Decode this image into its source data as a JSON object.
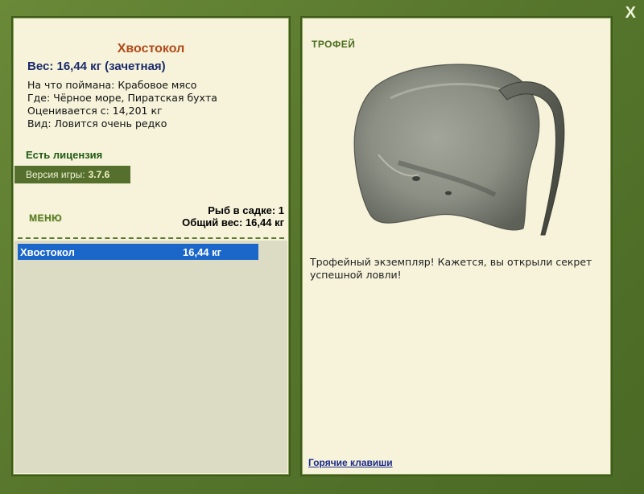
{
  "window": {
    "close_label": "X"
  },
  "fish": {
    "name": "Хвостокол",
    "weight_line": "Вес: 16,44 кг (зачетная)",
    "details": [
      "На что поймана: Крабовое мясо",
      "Где: Чёрное море, Пиратская бухта",
      "Оценивается с: 14,201 кг",
      "Вид: Ловится очень редко"
    ]
  },
  "license": "Есть лицензия",
  "version": {
    "label": "Версия игры:",
    "value": "3.7.6"
  },
  "menu_label": "МЕНЮ",
  "keepnet": {
    "count_line": "Рыб в садке: 1",
    "total_line": "Общий вес: 16,44 кг"
  },
  "catch_list": [
    {
      "name": "Хвостокол",
      "weight": "16,44 кг"
    }
  ],
  "trophy": {
    "label": "ТРОФЕЙ",
    "description": "Трофейный экземпляр! Кажется, вы открыли секрет успешной ловли!"
  },
  "hotkeys_link": "Горячие клавиши",
  "colors": {
    "frame_green": "#5c7a30",
    "panel_bg": "#f6f3da",
    "selection_blue": "#1b66c9",
    "title_orange": "#b14a1a",
    "weight_navy": "#1b2a6b"
  }
}
